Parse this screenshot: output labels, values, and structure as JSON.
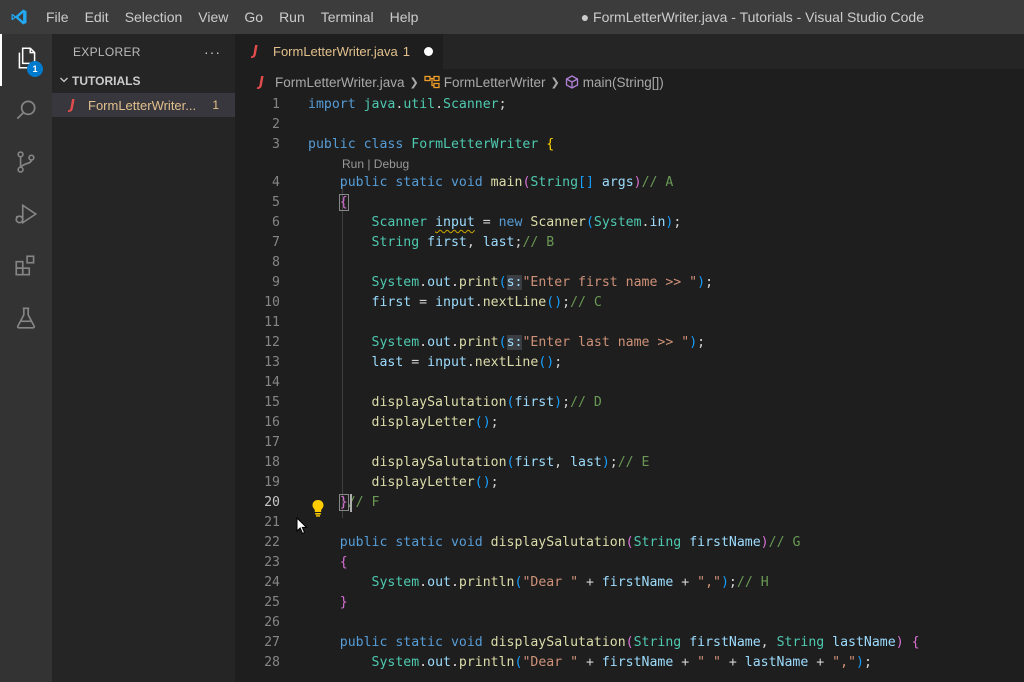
{
  "window": {
    "title": "● FormLetterWriter.java - Tutorials - Visual Studio Code",
    "menu": [
      "File",
      "Edit",
      "Selection",
      "View",
      "Go",
      "Run",
      "Terminal",
      "Help"
    ]
  },
  "activity_bar": {
    "items": [
      {
        "icon": "explorer-icon",
        "badge": "1"
      },
      {
        "icon": "search-icon"
      },
      {
        "icon": "source-control-icon"
      },
      {
        "icon": "run-debug-icon"
      },
      {
        "icon": "extensions-icon"
      },
      {
        "icon": "testing-flask-icon"
      }
    ]
  },
  "sidebar": {
    "title": "EXPLORER",
    "more": "···",
    "folder": "TUTORIALS",
    "file": {
      "name": "FormLetterWriter...",
      "problems": "1"
    }
  },
  "tab": {
    "name": "FormLetterWriter.java",
    "problems": "1"
  },
  "breadcrumb": {
    "file": "FormLetterWriter.java",
    "class": "FormLetterWriter",
    "method": "main(String[])"
  },
  "editor": {
    "codelens": "Run | Debug",
    "current_line": 20,
    "lines": [
      {
        "n": "1",
        "text": "import java.util.Scanner;"
      },
      {
        "n": "2",
        "text": ""
      },
      {
        "n": "3",
        "text": "public class FormLetterWriter {"
      },
      {
        "n": "4",
        "text": "    public static void main(String[] args)// A"
      },
      {
        "n": "5",
        "text": "    {"
      },
      {
        "n": "6",
        "text": "        Scanner input = new Scanner(System.in);"
      },
      {
        "n": "7",
        "text": "        String first, last;// B"
      },
      {
        "n": "8",
        "text": ""
      },
      {
        "n": "9",
        "text": "        System.out.print(s:\"Enter first name >> \");"
      },
      {
        "n": "10",
        "text": "        first = input.nextLine();// C"
      },
      {
        "n": "11",
        "text": ""
      },
      {
        "n": "12",
        "text": "        System.out.print(s:\"Enter last name >> \");"
      },
      {
        "n": "13",
        "text": "        last = input.nextLine();"
      },
      {
        "n": "14",
        "text": ""
      },
      {
        "n": "15",
        "text": "        displaySalutation(first);// D"
      },
      {
        "n": "16",
        "text": "        displayLetter();"
      },
      {
        "n": "17",
        "text": ""
      },
      {
        "n": "18",
        "text": "        displaySalutation(first, last);// E"
      },
      {
        "n": "19",
        "text": "        displayLetter();"
      },
      {
        "n": "20",
        "text": "    }// F"
      },
      {
        "n": "21",
        "text": ""
      },
      {
        "n": "22",
        "text": "    public static void displaySalutation(String firstName)// G"
      },
      {
        "n": "23",
        "text": "    {"
      },
      {
        "n": "24",
        "text": "        System.out.println(\"Dear \" + firstName + \",\");// H"
      },
      {
        "n": "25",
        "text": "    }"
      },
      {
        "n": "26",
        "text": ""
      },
      {
        "n": "27",
        "text": "    public static void displaySalutation(String firstName, String lastName) {"
      },
      {
        "n": "28",
        "text": "        System.out.println(\"Dear \" + firstName + \" \" + lastName + \",\");"
      }
    ]
  },
  "colors": {
    "keyword": "#569cd6",
    "type": "#4ec9b0",
    "function": "#dcdcaa",
    "variable": "#9cdcfe",
    "string": "#ce9178",
    "comment": "#6a9955",
    "modified_file": "#e2c08d",
    "accent": "#007acc"
  }
}
